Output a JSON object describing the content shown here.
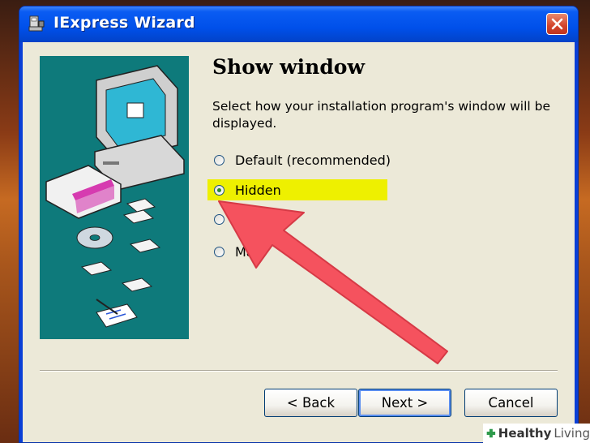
{
  "window": {
    "title": "IExpress Wizard"
  },
  "page": {
    "heading": "Show window",
    "description": "Select how your installation program's window will be displayed."
  },
  "options": [
    {
      "label": "Default (recommended)",
      "checked": false
    },
    {
      "label": "Hidden",
      "checked": true
    },
    {
      "label": "M",
      "checked": false
    },
    {
      "label": "Ma",
      "checked": false
    }
  ],
  "buttons": {
    "back": "< Back",
    "next": "Next >",
    "cancel": "Cancel"
  },
  "watermark": {
    "brand_a": "Healthy",
    "brand_b": "Living"
  },
  "colors": {
    "title_bar": "#0050ea",
    "client_bg": "#ece9d8",
    "highlight": "#eef000",
    "arrow": "#f5525e",
    "side_panel": "#0e7a7b"
  }
}
